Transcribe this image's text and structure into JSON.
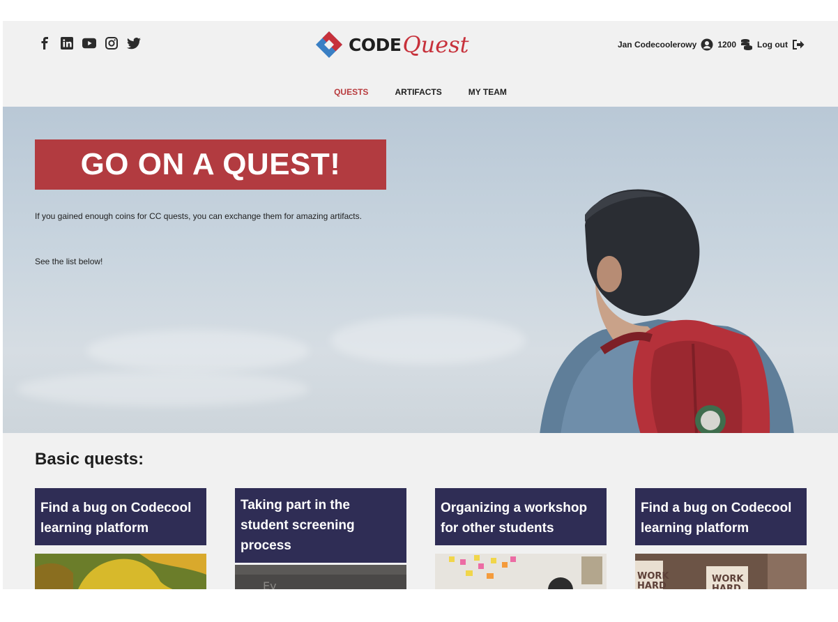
{
  "header": {
    "social": [
      {
        "icon": "facebook-icon"
      },
      {
        "icon": "linkedin-icon"
      },
      {
        "icon": "youtube-icon"
      },
      {
        "icon": "instagram-icon"
      },
      {
        "icon": "twitter-icon"
      }
    ],
    "logo": {
      "word": "CODE",
      "accent": "Quest"
    },
    "user": {
      "name": "Jan Codecoolerowy",
      "coins": "1200",
      "logout_label": "Log out"
    }
  },
  "nav": {
    "items": [
      {
        "label": "QUESTS",
        "active": true
      },
      {
        "label": "ARTIFACTS",
        "active": false
      },
      {
        "label": "MY TEAM",
        "active": false
      }
    ]
  },
  "hero": {
    "title": "GO ON A QUEST!",
    "text": "If you gained enough coins for CC quests, you can exchange them for amazing artifacts.",
    "text2": "See the list below!"
  },
  "quests": {
    "section_title": "Basic quests:",
    "cards": [
      {
        "title": "Find a bug on Codecool learning platform"
      },
      {
        "title": "Taking part in the student screening process"
      },
      {
        "title": "Organizing a workshop for other students"
      },
      {
        "title": "Find a bug on Codecool learning platform"
      }
    ]
  },
  "colors": {
    "accent": "#b23b40",
    "nav_active": "#b83b3e",
    "card_header": "#2f2d55",
    "page_bg": "#f1f1f1"
  }
}
